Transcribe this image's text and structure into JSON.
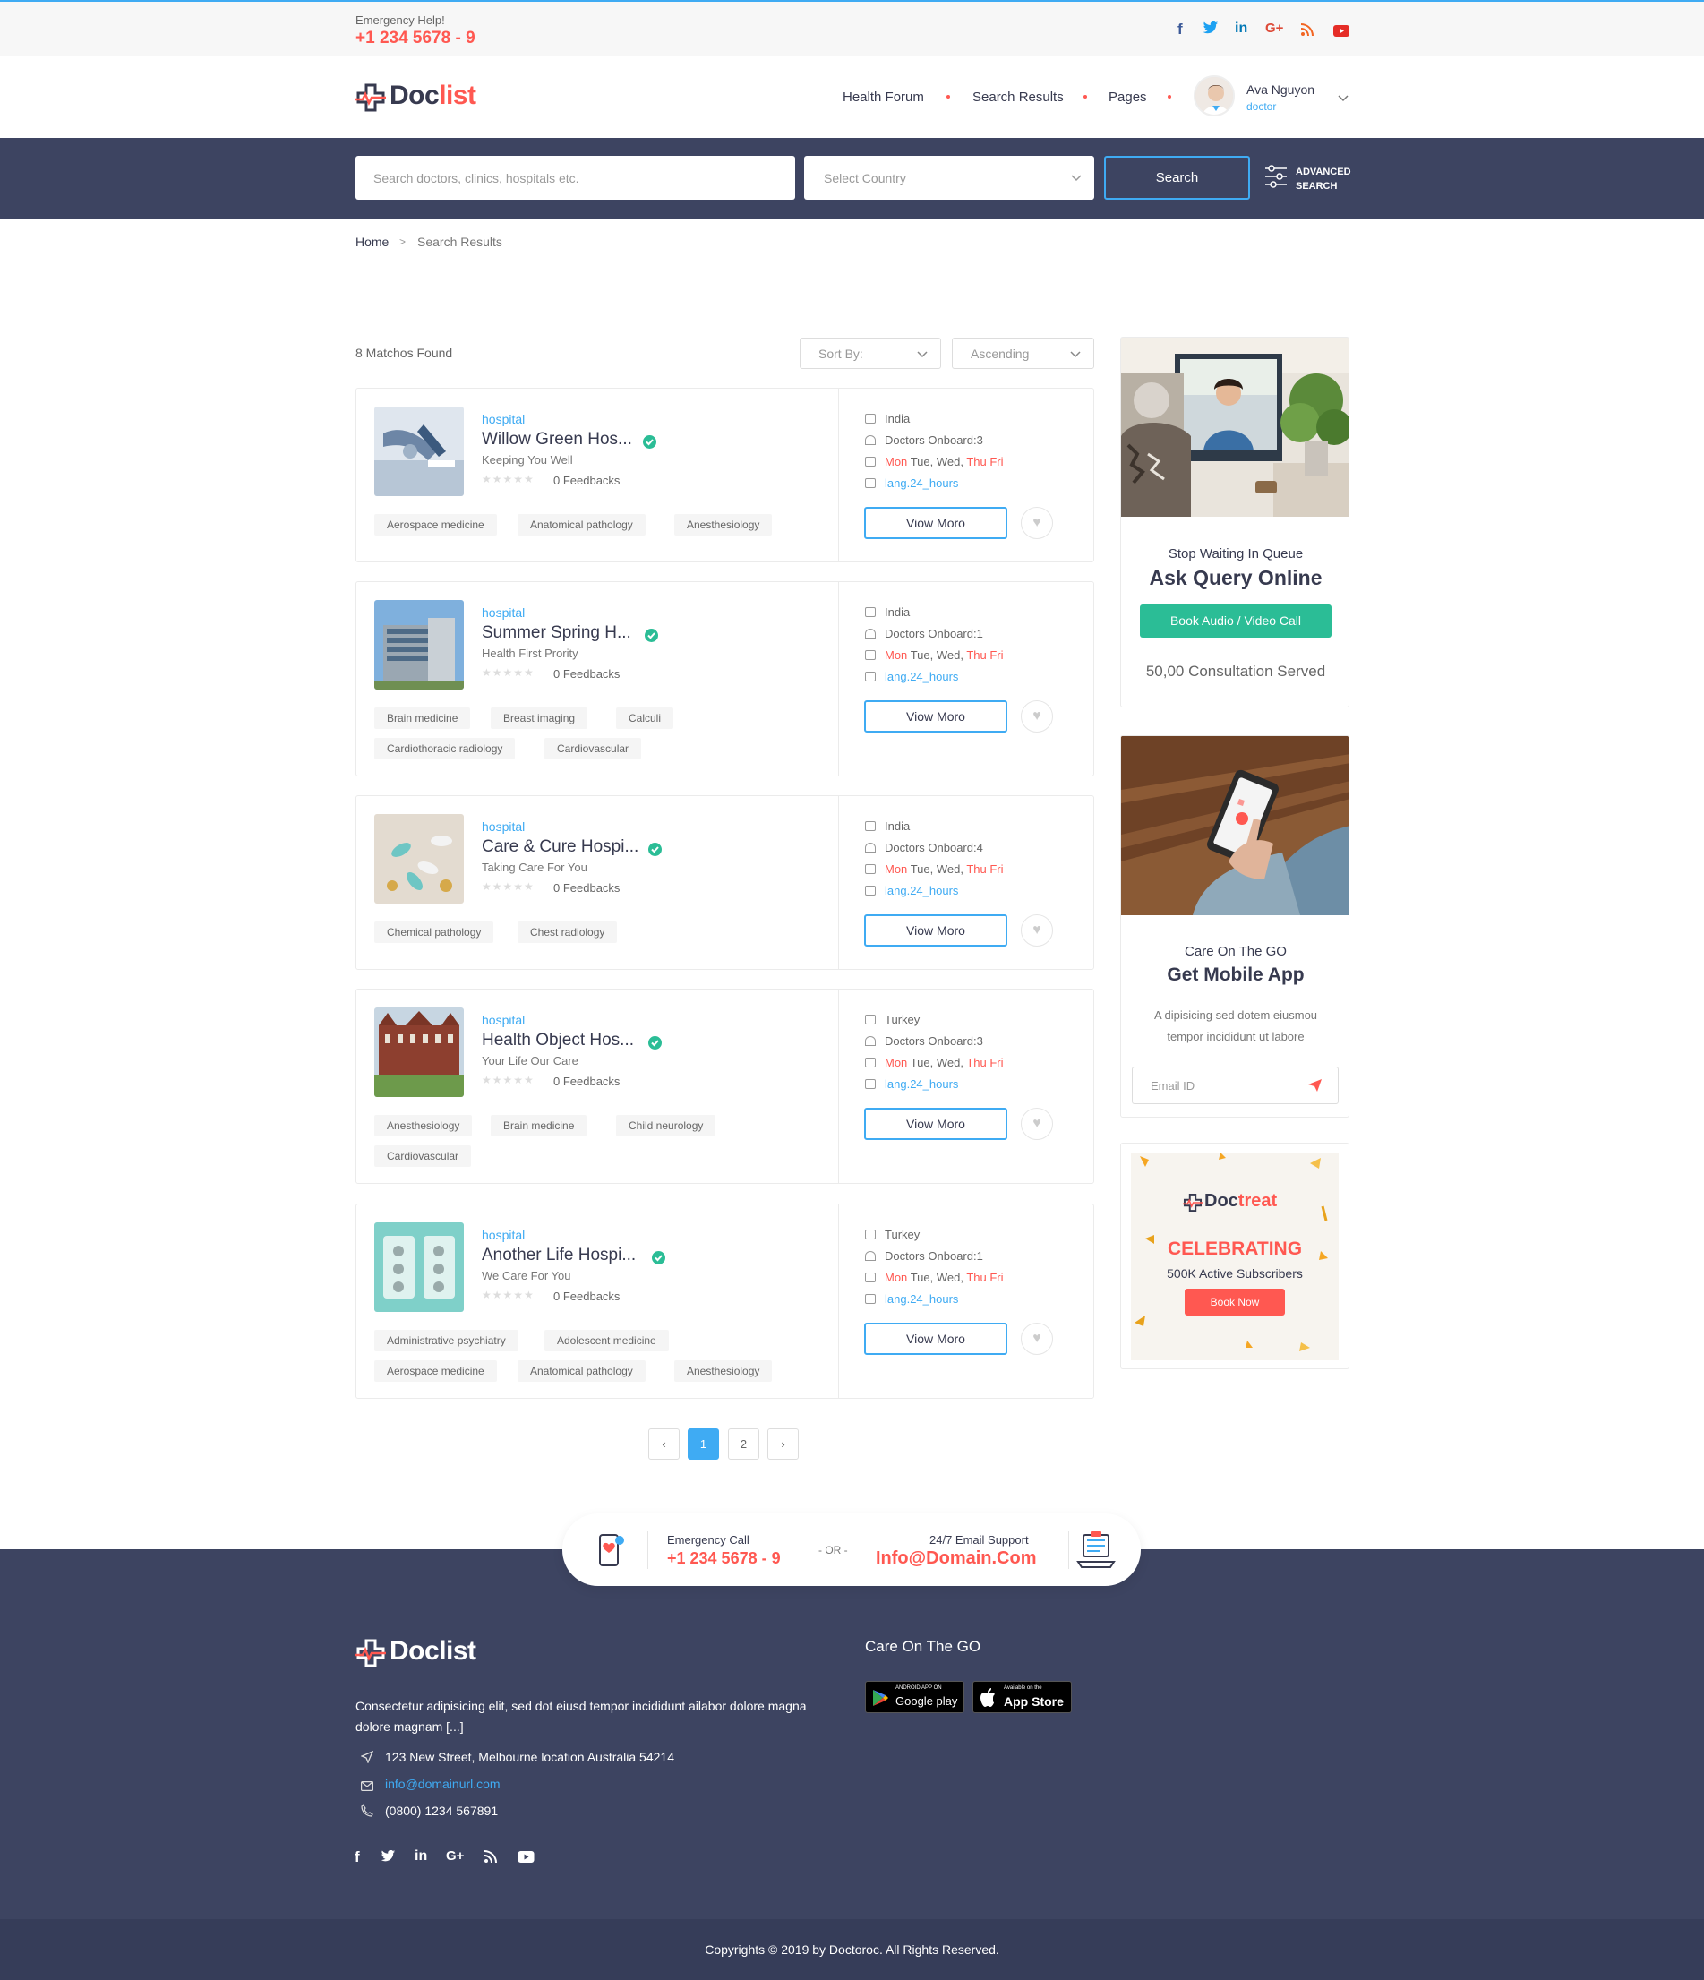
{
  "topbar": {
    "emergency_label": "Emergency Help!",
    "emergency_number": "+1 234 5678 - 9",
    "social": [
      "f",
      "t",
      "in",
      "G+",
      "rss",
      "yt"
    ]
  },
  "brand": {
    "part1": "Doc",
    "part2": "list",
    "accent": "#ff5851",
    "dark": "#373a4f",
    "blue": "#3fabf3",
    "navy": "#3d4461",
    "teal": "#2bbd96"
  },
  "nav": {
    "items": [
      "Health Forum",
      "Search Results",
      "Pages"
    ]
  },
  "user": {
    "name": "Ava Nguyon",
    "role": "doctor"
  },
  "search": {
    "placeholder": "Search doctors, clinics, hospitals etc.",
    "country": "Select Country",
    "button": "Search",
    "advanced_line1": "ADVANCED",
    "advanced_line2": "SEARCH"
  },
  "breadcrumb": {
    "home": "Home",
    "separator": ">",
    "current": "Search Results"
  },
  "results": {
    "count": "8 Matchos Found",
    "sort_by": "Sort By:",
    "order": "Ascending",
    "view_more": "Viow Moro",
    "feedbacks": "0 Feedbacks",
    "days_mon": "Mon",
    "days_mid": "Tue, Wed,",
    "days_end": "Thu Fri",
    "hours": "lang.24_hours",
    "items": [
      {
        "category": "hospital",
        "name": "Willow Green Hos...",
        "tagline": "Keeping You Well",
        "country": "India",
        "doctors": "Doctors Onboard:3",
        "tags": [
          "Aerospace medicine",
          "Anatomical pathology",
          "Anesthesiology"
        ]
      },
      {
        "category": "hospital",
        "name": "Summer Spring H...",
        "tagline": "Health First Prority",
        "country": "India",
        "doctors": "Doctors Onboard:1",
        "tags": [
          "Brain medicine",
          "Breast imaging",
          "Calculi",
          "Cardiothoracic radiology",
          "Cardiovascular"
        ]
      },
      {
        "category": "hospital",
        "name": "Care & Cure Hospi...",
        "tagline": "Taking Care For You",
        "country": "India",
        "doctors": "Doctors Onboard:4",
        "tags": [
          "Chemical pathology",
          "Chest radiology"
        ]
      },
      {
        "category": "hospital",
        "name": "Health Object Hos...",
        "tagline": "Your Life Our Care",
        "country": "Turkey",
        "doctors": "Doctors Onboard:3",
        "tags": [
          "Anesthesiology",
          "Brain medicine",
          "Child neurology",
          "Cardiovascular"
        ]
      },
      {
        "category": "hospital",
        "name": "Another Life Hospi...",
        "tagline": "We Care For You",
        "country": "Turkey",
        "doctors": "Doctors Onboard:1",
        "tags": [
          "Administrative psychiatry",
          "Adolescent medicine",
          "Aerospace medicine",
          "Anatomical pathology",
          "Anesthesiology"
        ]
      }
    ]
  },
  "pagination": {
    "prev": "‹",
    "pages": [
      "1",
      "2"
    ],
    "next": "›"
  },
  "sidebar": {
    "query": {
      "subtitle": "Stop Waiting In Queue",
      "title": "Ask Query Online",
      "button": "Book Audio / Video Call",
      "served": "50,00 Consultation Served"
    },
    "app": {
      "subtitle": "Care On The GO",
      "title": "Get Mobile App",
      "desc_line1": "A dipisicing sed dotem eiusmou",
      "desc_line2": "tempor incididunt ut labore",
      "email_placeholder": "Email ID"
    },
    "ad": {
      "logo1": "Doc",
      "logo2": "treat",
      "headline": "CELEBRATING",
      "sub": "500K Active Subscribers",
      "button": "Book Now"
    }
  },
  "contact_pill": {
    "call_label": "Emergency Call",
    "call_number": "+1 234 5678 - 9",
    "or": "- OR -",
    "email_label": "24/7 Email Support",
    "email": "Info@Domain.Com"
  },
  "footer": {
    "desc_line1": "Consectetur adipisicing elit, sed dot eiusd tempor incididunt ailabor dolore magna",
    "desc_line2": "dolore magnam [...]",
    "address": "123 New Street, Melbourne location Australia 54214",
    "email": "info@domainurl.com",
    "phone": "(0800) 1234 567891",
    "app_title": "Care On The GO",
    "google_small": "ANDROID APP ON",
    "google_big": "Google play",
    "apple_small": "Available on the",
    "apple_big": "App Store",
    "copyright": "Copyrights © 2019 by Doctoroc. All Rights Reserved."
  }
}
